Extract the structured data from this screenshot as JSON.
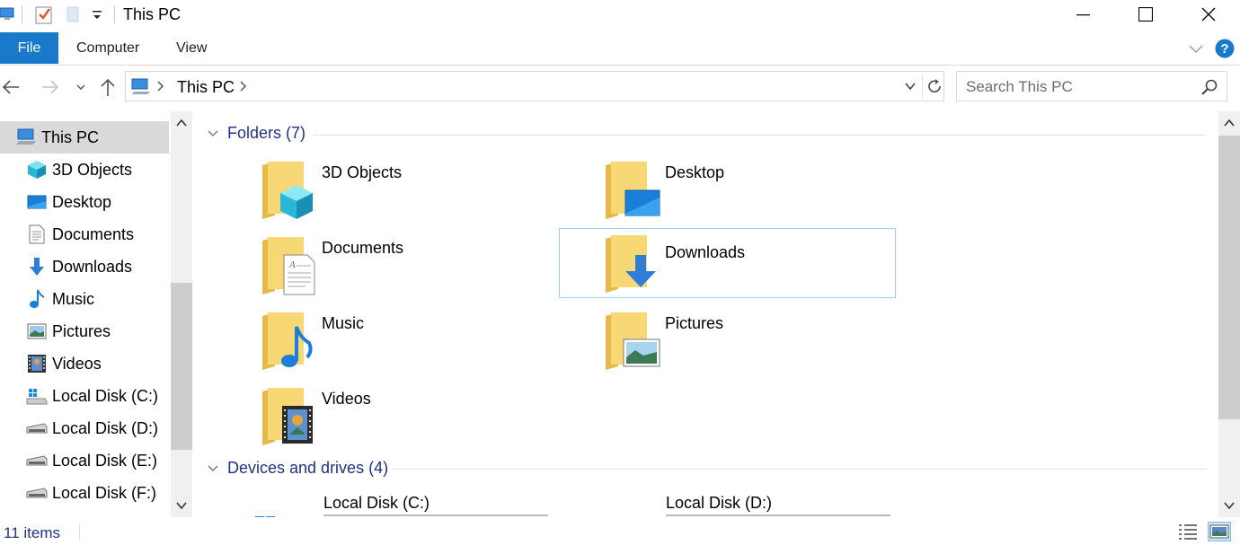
{
  "window": {
    "title": "This PC"
  },
  "ribbon": {
    "tabs": [
      {
        "label": "File",
        "active": true
      },
      {
        "label": "Computer",
        "active": false
      },
      {
        "label": "View",
        "active": false
      }
    ]
  },
  "address": {
    "path": [
      "This PC"
    ]
  },
  "search": {
    "placeholder": "Search This PC"
  },
  "navpane": {
    "items": [
      {
        "label": "This PC",
        "icon": "computer-icon",
        "selected": true
      },
      {
        "label": "3D Objects",
        "icon": "cube-icon"
      },
      {
        "label": "Desktop",
        "icon": "desktop-icon"
      },
      {
        "label": "Documents",
        "icon": "document-icon"
      },
      {
        "label": "Downloads",
        "icon": "download-arrow-icon"
      },
      {
        "label": "Music",
        "icon": "music-note-icon"
      },
      {
        "label": "Pictures",
        "icon": "picture-icon"
      },
      {
        "label": "Videos",
        "icon": "film-icon"
      },
      {
        "label": "Local Disk (C:)",
        "icon": "windows-drive-icon"
      },
      {
        "label": "Local Disk (D:)",
        "icon": "drive-icon"
      },
      {
        "label": "Local Disk (E:)",
        "icon": "drive-icon"
      },
      {
        "label": "Local Disk (F:)",
        "icon": "drive-icon"
      }
    ]
  },
  "content": {
    "folders_header": "Folders (7)",
    "folders": [
      {
        "label": "3D Objects",
        "icon": "folder-3d-objects-icon"
      },
      {
        "label": "Desktop",
        "icon": "folder-desktop-icon"
      },
      {
        "label": "Documents",
        "icon": "folder-documents-icon"
      },
      {
        "label": "Downloads",
        "icon": "folder-downloads-icon",
        "focused": true
      },
      {
        "label": "Music",
        "icon": "folder-music-icon"
      },
      {
        "label": "Pictures",
        "icon": "folder-pictures-icon"
      },
      {
        "label": "Videos",
        "icon": "folder-videos-icon"
      }
    ],
    "drives_header": "Devices and drives (4)",
    "drives": [
      {
        "label": "Local Disk (C:)",
        "icon": "windows-drive-icon"
      },
      {
        "label": "Local Disk (D:)",
        "icon": "drive-icon"
      }
    ]
  },
  "status": {
    "item_count": "11 items"
  },
  "colors": {
    "accent": "#1979ca",
    "group_header": "#1e3287",
    "selection": "#cce8ff",
    "nav_selected": "#d9d9d9",
    "folder": "#f8d775"
  }
}
